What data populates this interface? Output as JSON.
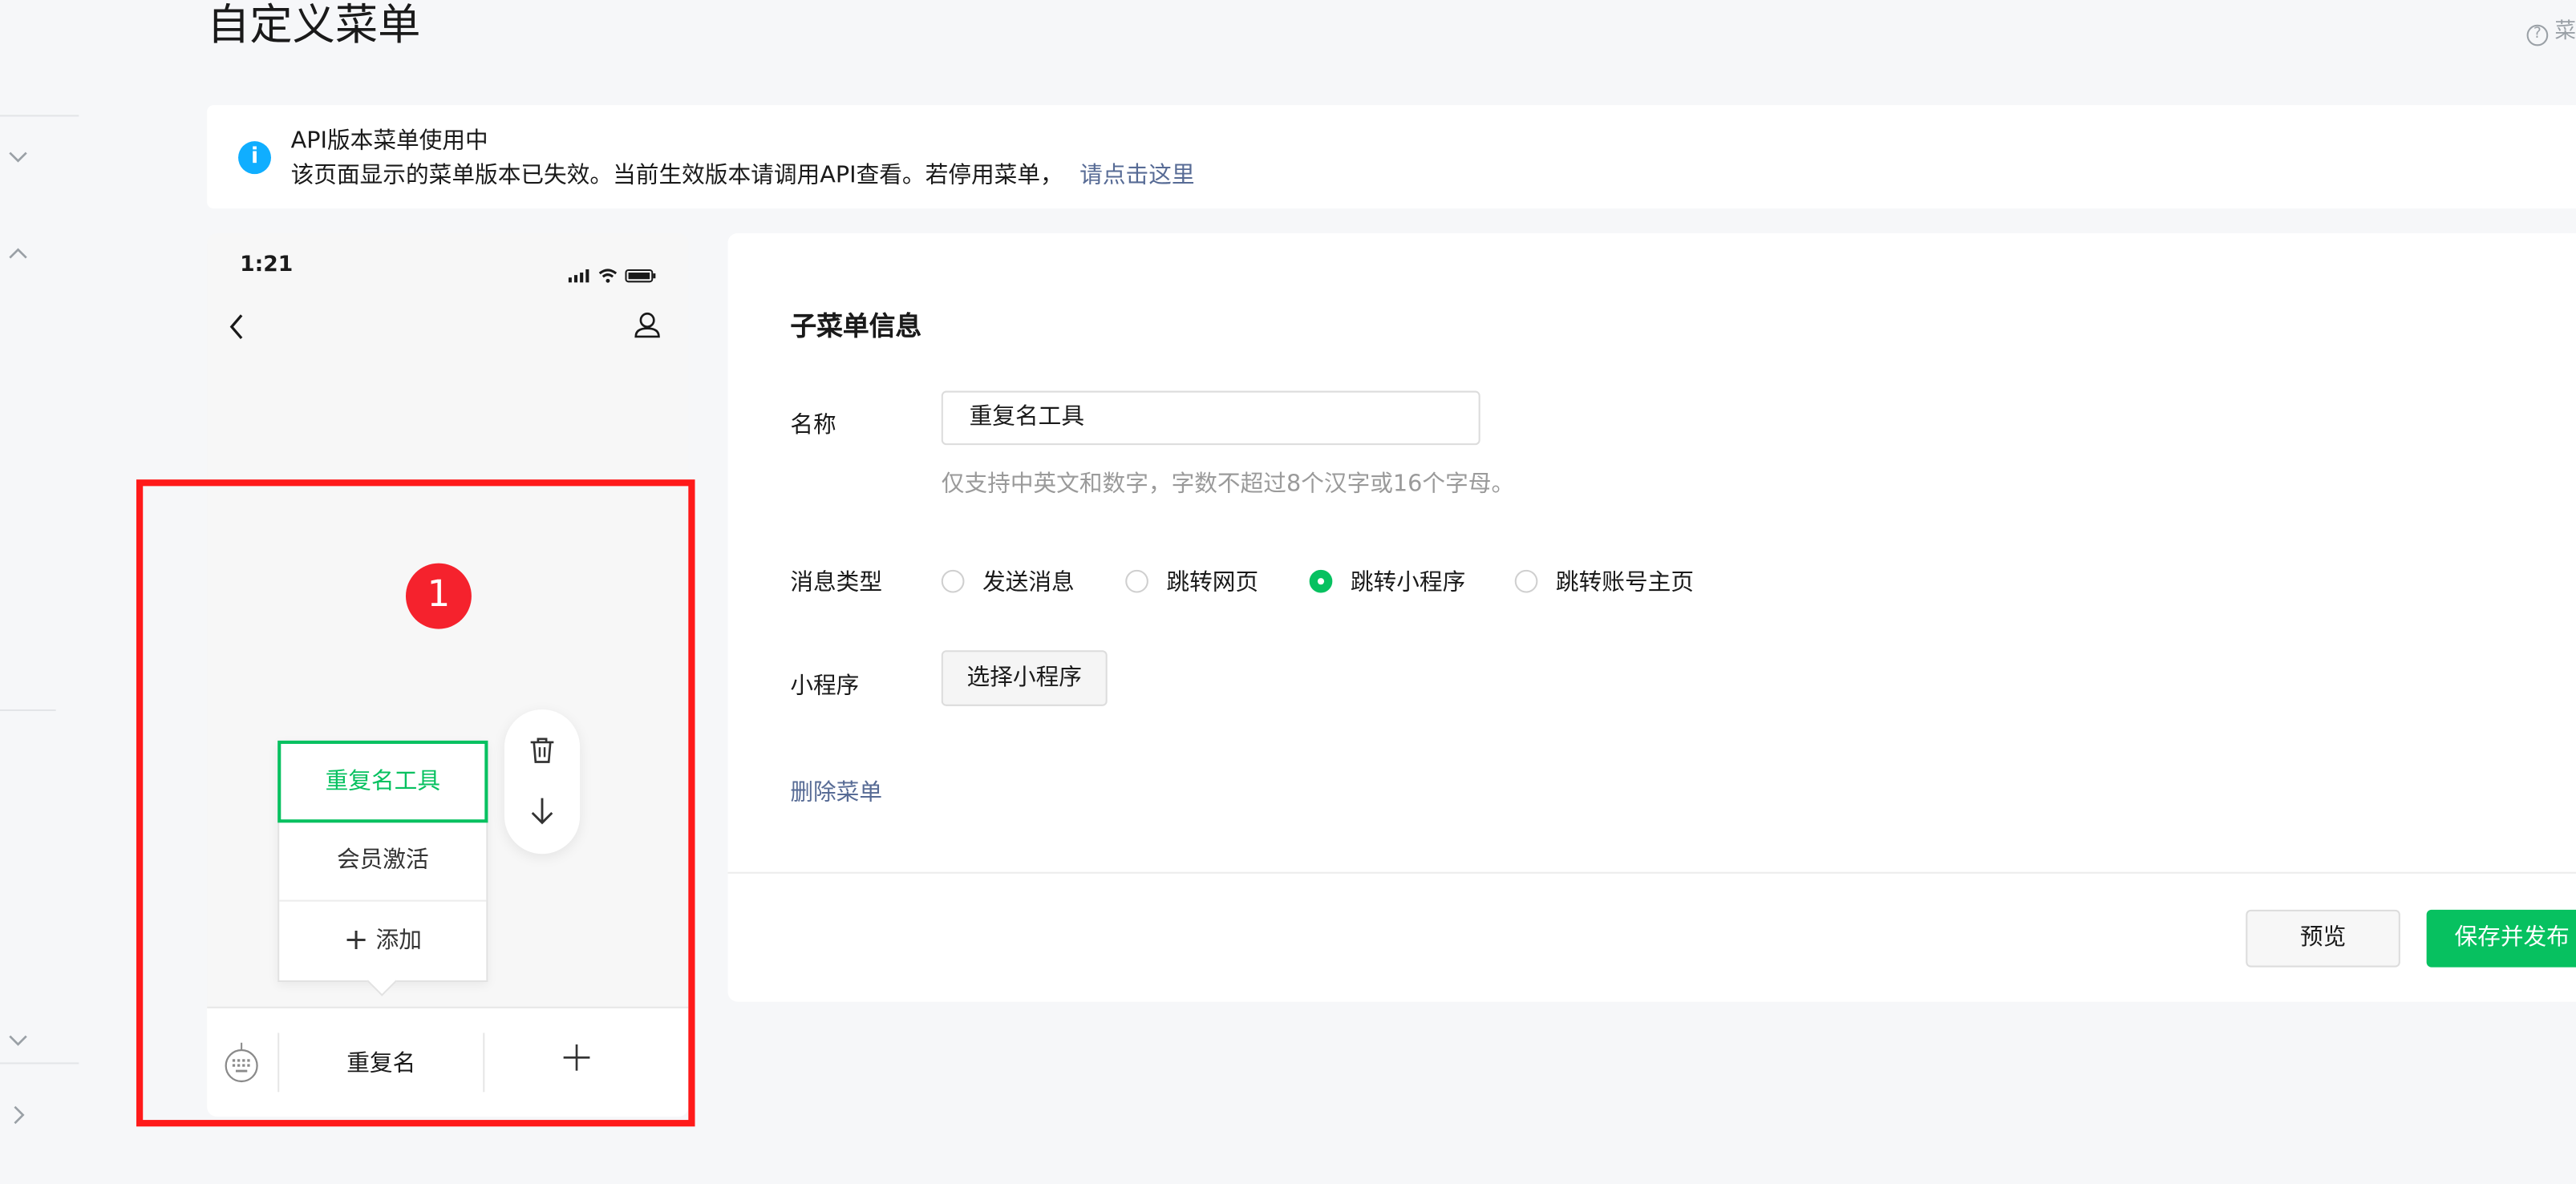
{
  "page": {
    "title": "自定义菜单",
    "help_text": "菜"
  },
  "notice": {
    "title": "API版本菜单使用中",
    "message": "该页面显示的菜单版本已失效。当前生效版本请调用API查看。若停用菜单，",
    "link": "请点击这里"
  },
  "phone": {
    "time": "1:21",
    "badge_number": "1",
    "submenu": [
      {
        "label": "重复名工具",
        "active": true
      },
      {
        "label": "会员激活",
        "active": false
      }
    ],
    "add_label": "添加",
    "menubar_item": "重复名"
  },
  "form": {
    "heading": "子菜单信息",
    "name_label": "名称",
    "name_value": "重复名工具",
    "name_hint": "仅支持中英文和数字，字数不超过8个汉字或16个字母。",
    "type_label": "消息类型",
    "types": [
      {
        "label": "发送消息",
        "selected": false
      },
      {
        "label": "跳转网页",
        "selected": false
      },
      {
        "label": "跳转小程序",
        "selected": true
      },
      {
        "label": "跳转账号主页",
        "selected": false
      }
    ],
    "miniprogram_label": "小程序",
    "select_button": "选择小程序",
    "delete_link": "删除菜单"
  },
  "footer": {
    "preview_button": "预览",
    "publish_button": "保存并发布"
  },
  "colors": {
    "brand_green": "#07c160",
    "link_blue": "#576b95",
    "info_blue": "#10aeff",
    "highlight_red": "#ff1a1a"
  }
}
